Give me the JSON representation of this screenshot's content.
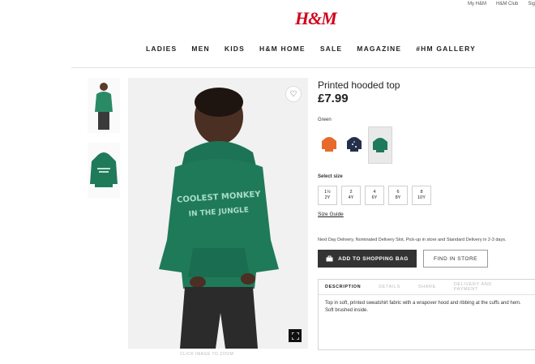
{
  "header": {
    "top_links": [
      "My H&M",
      "H&M Club",
      "Sig"
    ],
    "logo_text": "H&M",
    "nav": [
      "LADIES",
      "MEN",
      "KIDS",
      "H&M HOME",
      "SALE",
      "MAGAZINE",
      "#HM GALLERY"
    ]
  },
  "gallery": {
    "click_hint": "CLICK IMAGE TO ZOOM",
    "icons": {
      "wishlist": "heart-icon",
      "zoom": "expand-icon"
    }
  },
  "product": {
    "title": "Printed hooded top",
    "price": "£7.99",
    "color_label": "Green",
    "colors": [
      "#e8692c",
      "#24304a",
      "#1f7a5a"
    ],
    "selected_color_index": 2,
    "size_label": "Select size",
    "sizes": [
      {
        "top": "1½",
        "bottom": "2Y"
      },
      {
        "top": "2",
        "bottom": "4Y"
      },
      {
        "top": "4",
        "bottom": "6Y"
      },
      {
        "top": "6",
        "bottom": "8Y"
      },
      {
        "top": "8",
        "bottom": "10Y"
      }
    ],
    "size_guide": "Size Guide",
    "delivery": "Next Day Delivery, Nominated Delivery Slot, Pick-up in store and Standard Delivery in 2-3 days.",
    "add_to_bag": "ADD TO SHOPPING BAG",
    "find_in_store": "FIND IN STORE",
    "tabs": [
      "DESCRIPTION",
      "DETAILS",
      "SHARE",
      "DELIVERY AND PAYMENT"
    ],
    "active_tab": 0,
    "description": "Top in soft, printed sweatshirt fabric with a wrapover hood and ribbing at the cuffs and hem. Soft brushed inside."
  },
  "brand_colors": {
    "logo": "#d0021b",
    "hoodie": "#1f7a5a",
    "button": "#333333"
  }
}
